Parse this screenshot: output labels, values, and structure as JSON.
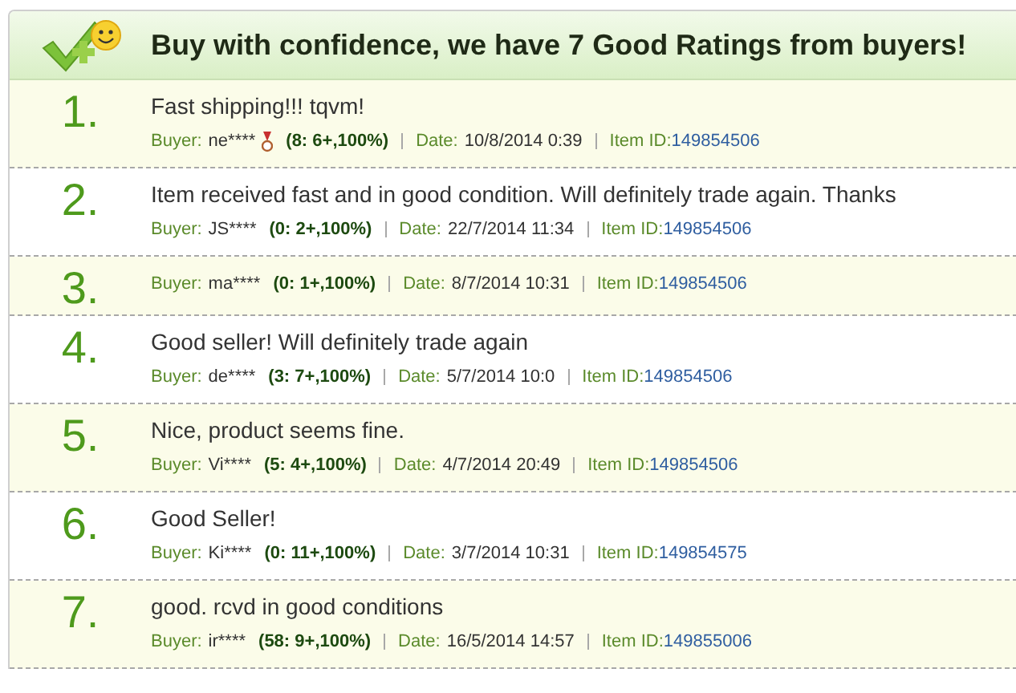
{
  "header": {
    "title": "Buy with confidence, we have 7 Good Ratings from buyers!"
  },
  "ratings": [
    {
      "number": "1.",
      "comment": "Fast shipping!!! tqvm!",
      "buyer_label": "Buyer:",
      "buyer": "ne****",
      "medal": true,
      "rating": "(8: 6+,100%)",
      "date_label": "Date:",
      "date": "10/8/2014 0:39",
      "item_label": "Item ID:",
      "item_id": "149854506"
    },
    {
      "number": "2.",
      "comment": "Item received fast and in good condition. Will definitely trade again. Thanks",
      "buyer_label": "Buyer:",
      "buyer": "JS****",
      "medal": false,
      "rating": "(0: 2+,100%)",
      "date_label": "Date:",
      "date": "22/7/2014 11:34",
      "item_label": "Item ID:",
      "item_id": "149854506"
    },
    {
      "number": "3.",
      "buyer_label": "Buyer:",
      "buyer": "ma****",
      "medal": false,
      "rating": "(0: 1+,100%)",
      "date_label": "Date:",
      "date": "8/7/2014 10:31",
      "item_label": "Item ID:",
      "item_id": "149854506"
    },
    {
      "number": "4.",
      "comment": "Good seller! Will definitely trade again",
      "buyer_label": "Buyer:",
      "buyer": "de****",
      "medal": false,
      "rating": "(3: 7+,100%)",
      "date_label": "Date:",
      "date": "5/7/2014 10:0",
      "item_label": "Item ID:",
      "item_id": "149854506"
    },
    {
      "number": "5.",
      "comment": "Nice, product seems fine.",
      "buyer_label": "Buyer:",
      "buyer": "Vi****",
      "medal": false,
      "rating": "(5: 4+,100%)",
      "date_label": "Date:",
      "date": "4/7/2014 20:49",
      "item_label": "Item ID:",
      "item_id": "149854506"
    },
    {
      "number": "6.",
      "comment": "Good Seller!",
      "buyer_label": "Buyer:",
      "buyer": "Ki****",
      "medal": false,
      "rating": "(0: 11+,100%)",
      "date_label": "Date:",
      "date": "3/7/2014 10:31",
      "item_label": "Item ID:",
      "item_id": "149854575"
    },
    {
      "number": "7.",
      "comment": "good. rcvd in good conditions",
      "buyer_label": "Buyer:",
      "buyer": "ir****",
      "medal": false,
      "rating": "(58: 9+,100%)",
      "date_label": "Date:",
      "date": "16/5/2014 14:57",
      "item_label": "Item ID:",
      "item_id": "149855006"
    }
  ]
}
